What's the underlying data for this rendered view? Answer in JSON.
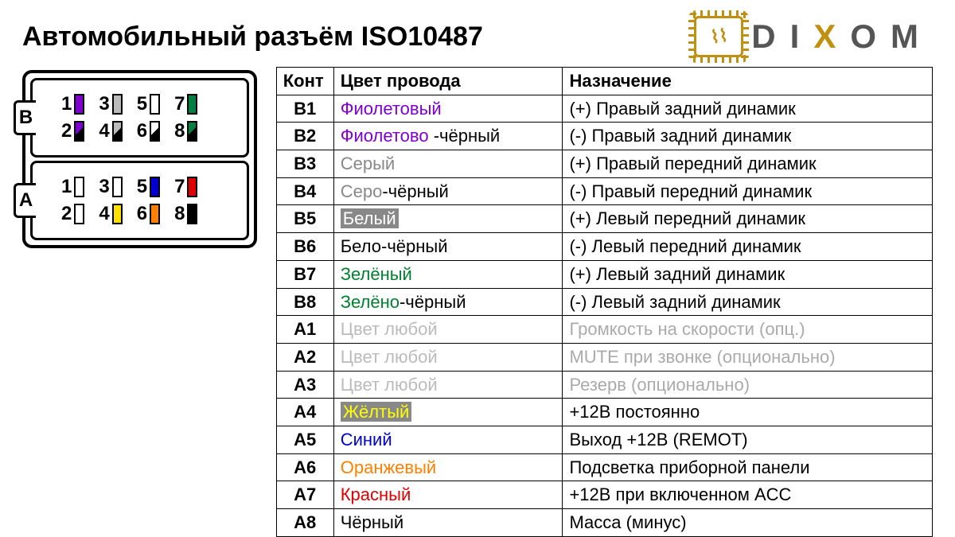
{
  "title": "Автомобильный разъём ISO10487",
  "logo": {
    "d": "D",
    "i": "I",
    "x": "X",
    "o": "O",
    "m": "M"
  },
  "headers": {
    "pin": "Конт",
    "color": "Цвет провода",
    "func": "Назначение"
  },
  "connector": {
    "B": {
      "label": "B",
      "rows": [
        [
          {
            "n": "1",
            "c": "#8000d0",
            "style": "solid"
          },
          {
            "n": "3",
            "c": "#bbb",
            "style": "solid"
          },
          {
            "n": "5",
            "c": "#fff",
            "style": "white"
          },
          {
            "n": "7",
            "c": "#008040",
            "style": "solid"
          }
        ],
        [
          {
            "n": "2",
            "c": "#8000d0",
            "style": "half"
          },
          {
            "n": "4",
            "c": "#bbb",
            "style": "half"
          },
          {
            "n": "6",
            "c": "#fff",
            "style": "half"
          },
          {
            "n": "8",
            "c": "#008040",
            "style": "half"
          }
        ]
      ]
    },
    "A": {
      "label": "A",
      "rows": [
        [
          {
            "n": "1",
            "c": "#fff",
            "style": "white"
          },
          {
            "n": "3",
            "c": "#fff",
            "style": "white"
          },
          {
            "n": "5",
            "c": "#0000d0",
            "style": "solid"
          },
          {
            "n": "7",
            "c": "#e00000",
            "style": "solid"
          }
        ],
        [
          {
            "n": "2",
            "c": "#fff",
            "style": "white"
          },
          {
            "n": "4",
            "c": "#ffe000",
            "style": "solid"
          },
          {
            "n": "6",
            "c": "#ff8000",
            "style": "solid"
          },
          {
            "n": "8",
            "c": "#000",
            "style": "solid"
          }
        ]
      ]
    }
  },
  "rows": [
    {
      "id": "B1",
      "color": [
        {
          "t": "Фиолетовый",
          "c": "#8000d0"
        }
      ],
      "func": "(+) Правый задний динамик"
    },
    {
      "id": "B2",
      "color": [
        {
          "t": "Фиолетово ",
          "c": "#8000d0"
        },
        {
          "t": "-чёрный",
          "c": "#000"
        }
      ],
      "func": "(-)  Правый задний динамик"
    },
    {
      "id": "B3",
      "color": [
        {
          "t": "Серый",
          "c": "#888"
        }
      ],
      "func": "(+) Правый передний динамик"
    },
    {
      "id": "B4",
      "color": [
        {
          "t": "Серо",
          "c": "#888"
        },
        {
          "t": "-чёрный",
          "c": "#000"
        }
      ],
      "func": "(-)  Правый передний динамик"
    },
    {
      "id": "B5",
      "color": [
        {
          "t": "Белый",
          "hl": "grey"
        }
      ],
      "func": "(+) Левый передний динамик"
    },
    {
      "id": "B6",
      "color": [
        {
          "t": "Бело",
          "c": "#000"
        },
        {
          "t": "-чёрный",
          "c": "#000"
        }
      ],
      "func": "(-)  Левый передний динамик"
    },
    {
      "id": "B7",
      "color": [
        {
          "t": "Зелёный",
          "c": "#008030"
        }
      ],
      "func": "(+) Левый задний динамик"
    },
    {
      "id": "B8",
      "color": [
        {
          "t": "Зелёно",
          "c": "#008030"
        },
        {
          "t": "-чёрный",
          "c": "#000"
        }
      ],
      "func": "(-)  Левый задний динамик"
    },
    {
      "id": "A1",
      "color": [
        {
          "t": "Цвет любой",
          "c": "#bbb"
        }
      ],
      "func": "Громкость на скорости (опц.)",
      "muted": true
    },
    {
      "id": "A2",
      "color": [
        {
          "t": "Цвет любой",
          "c": "#bbb"
        }
      ],
      "func": "MUTE при звонке (опционально)",
      "muted": true
    },
    {
      "id": "A3",
      "color": [
        {
          "t": "Цвет любой",
          "c": "#bbb"
        }
      ],
      "func": "Резерв (опционально)",
      "muted": true
    },
    {
      "id": "A4",
      "color": [
        {
          "t": "Жёлтый",
          "hl": "yellow"
        }
      ],
      "func": "+12В постоянно"
    },
    {
      "id": "A5",
      "color": [
        {
          "t": "Синий",
          "c": "#0000d0"
        }
      ],
      "func": "Выход +12В (REMOT)"
    },
    {
      "id": "A6",
      "color": [
        {
          "t": "Оранжевый",
          "c": "#ff8000"
        }
      ],
      "func": "Подсветка приборной панели"
    },
    {
      "id": "A7",
      "color": [
        {
          "t": "Красный",
          "c": "#e00000"
        }
      ],
      "func": "+12В при включенном ACC"
    },
    {
      "id": "A8",
      "color": [
        {
          "t": "Чёрный",
          "c": "#000"
        }
      ],
      "func": "Масса (минус)"
    }
  ]
}
